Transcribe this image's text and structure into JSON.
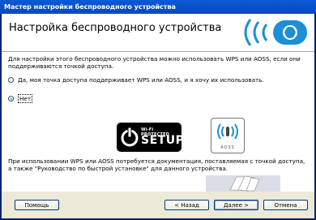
{
  "window": {
    "title": "Мастер настройки беспроводного устройства"
  },
  "header": {
    "title": "Настройка беспроводного устройства"
  },
  "main": {
    "intro": "Для настройки этого беспроводного устройства можно использовать WPS или AOSS, если они поддерживаются точкой доступа.",
    "options": [
      {
        "label": "Да, моя точка доступа поддерживает WPS или AOSS, и я хочу их использовать.",
        "selected": false
      },
      {
        "label": "Нет",
        "selected": true
      }
    ],
    "wps_logo": {
      "top": "Wi-Fi PROTECTED",
      "bottom": "SETUP"
    },
    "aoss_logo": {
      "label": "AOSS"
    },
    "note": "При использовании WPS или AOSS потребуется документация, поставляемая с точкой доступа, а также \"Руководство по быстрой установке\" для данного устройства."
  },
  "footer": {
    "help": "Помощь",
    "back": "< Назад",
    "next": "Далее >",
    "cancel": "Отмена"
  }
}
